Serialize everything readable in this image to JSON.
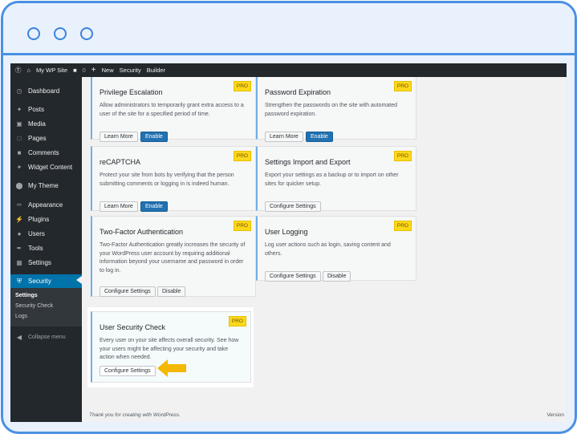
{
  "adminbar": {
    "site_name": "My WP Site",
    "comments_count": "0",
    "new_label": "New",
    "security_label": "Security",
    "builder_label": "Builder"
  },
  "sidebar": {
    "items": [
      {
        "label": "Dashboard",
        "icon": "dashboard-icon"
      },
      {
        "label": "Posts",
        "icon": "pin-icon"
      },
      {
        "label": "Media",
        "icon": "media-icon"
      },
      {
        "label": "Pages",
        "icon": "page-icon"
      },
      {
        "label": "Comments",
        "icon": "comment-icon"
      },
      {
        "label": "Widget Content",
        "icon": "pin-icon"
      },
      {
        "label": "My Theme",
        "icon": "theme-icon"
      },
      {
        "label": "Appearance",
        "icon": "brush-icon"
      },
      {
        "label": "Plugins",
        "icon": "plug-icon"
      },
      {
        "label": "Users",
        "icon": "user-icon"
      },
      {
        "label": "Tools",
        "icon": "wrench-icon"
      },
      {
        "label": "Settings",
        "icon": "settings-icon"
      },
      {
        "label": "Security",
        "icon": "shield-icon"
      }
    ],
    "submenu": [
      "Settings",
      "Security Check",
      "Logs"
    ],
    "collapse": "Collapse menu"
  },
  "cards": {
    "privilege": {
      "title": "Privilege Escalation",
      "desc": "Allow administrators to temporarily grant extra access to a user of the site for a specified period of time.",
      "learn": "Learn More",
      "enable": "Enable",
      "badge": "PRO"
    },
    "password": {
      "title": "Password Expiration",
      "desc": "Strengthen the passwords on the site with automated password expiration.",
      "learn": "Learn More",
      "enable": "Enable",
      "badge": "PRO"
    },
    "recaptcha": {
      "title": "reCAPTCHA",
      "desc": "Protect your site from bots by verifying that the person submitting comments or logging in is indeed human.",
      "learn": "Learn More",
      "enable": "Enable",
      "badge": "PRO"
    },
    "import": {
      "title": "Settings Import and Export",
      "desc": "Export your settings as a backup or to import on other sites for quicker setup.",
      "configure": "Configure Settings",
      "badge": "PRO"
    },
    "twofactor": {
      "title": "Two-Factor Authentication",
      "desc": "Two-Factor Authentication greatly increases the security of your WordPress user account by requiring additional information beyond your username and password in order to log in.",
      "configure": "Configure Settings",
      "disable": "Disable",
      "badge": "PRO"
    },
    "logging": {
      "title": "User Logging",
      "desc": "Log user actions such as login, saving content and others.",
      "configure": "Configure Settings",
      "disable": "Disable",
      "badge": "PRO"
    },
    "securitycheck": {
      "title": "User Security Check",
      "desc": "Every user on your site affects overall security. See how your users might be affecting your security and take action when needed.",
      "configure": "Configure Settings",
      "badge": "PRO"
    }
  },
  "footer": {
    "thanks": "Thank you for creating with WordPress.",
    "version": "Version"
  },
  "colors": {
    "accent": "#0073aa",
    "badge": "#ffd81b",
    "frame": "#4a90e2",
    "arrow": "#f5b800"
  }
}
